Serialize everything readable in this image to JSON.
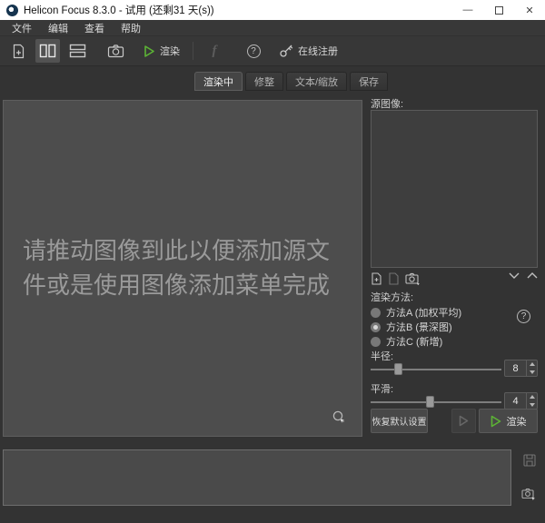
{
  "titlebar": {
    "title": "Helicon Focus 8.3.0 - 试用 (还剩31 天(s))",
    "minimize": "—",
    "close": "✕"
  },
  "menubar": {
    "file": "文件",
    "edit": "编辑",
    "view": "查看",
    "help": "帮助"
  },
  "toolbar": {
    "render_label": "渲染",
    "facebook_label": "f",
    "help_label": "?",
    "register_label": "在线注册"
  },
  "tabs": {
    "rendering": "渲染中",
    "retouch": "修整",
    "text_scale": "文本/缩放",
    "save": "保存"
  },
  "canvas": {
    "hint": "请推动图像到此以便添加源文件或是使用图像添加菜单完成"
  },
  "right_panel": {
    "source_label": "源图像:",
    "method_label": "渲染方法:",
    "method_a": "方法A (加权平均)",
    "method_b": "方法B (景深图)",
    "method_c": "方法C (新增)",
    "help_label": "?",
    "radius_label": "半径:",
    "radius_value": "8",
    "smoothing_label": "平滑:",
    "smoothing_value": "4",
    "reset_label": "恢复默认设置",
    "render_label": "渲染"
  },
  "colors": {
    "accent_green": "#5cb335",
    "titlebar_bg": "#ffffff",
    "window_bg": "#333333",
    "canvas_bg": "#4d4d4d"
  }
}
